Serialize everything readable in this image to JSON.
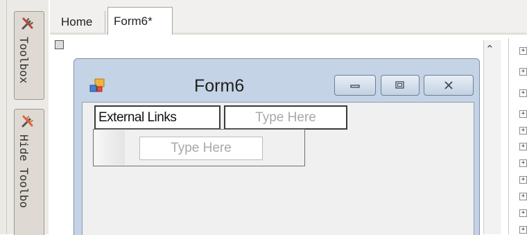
{
  "sidebar": {
    "toolbox_label": "Toolbox",
    "hide_toolbox_label": "Hide Toolbo"
  },
  "tabs": [
    {
      "label": "Home"
    },
    {
      "label": "Form6*"
    }
  ],
  "form": {
    "title": "Form6",
    "menu": {
      "items": [
        "External Links",
        "Type Here"
      ],
      "submenu_placeholder": "Type Here"
    }
  },
  "icons": {
    "toolbox": "tools-icon",
    "hide_toolbox": "tools-icon",
    "form": "form-app-icon",
    "minimize": "minimize-icon",
    "maximize": "maximize-icon",
    "close": "close-icon",
    "scroll_up": "chevron-up-icon",
    "tree_expand": "plus-box-icon"
  },
  "colors": {
    "form_caption": "#c4d4e6",
    "client_area": "#f0f0f0",
    "placeholder_text": "#a8a8a8"
  }
}
